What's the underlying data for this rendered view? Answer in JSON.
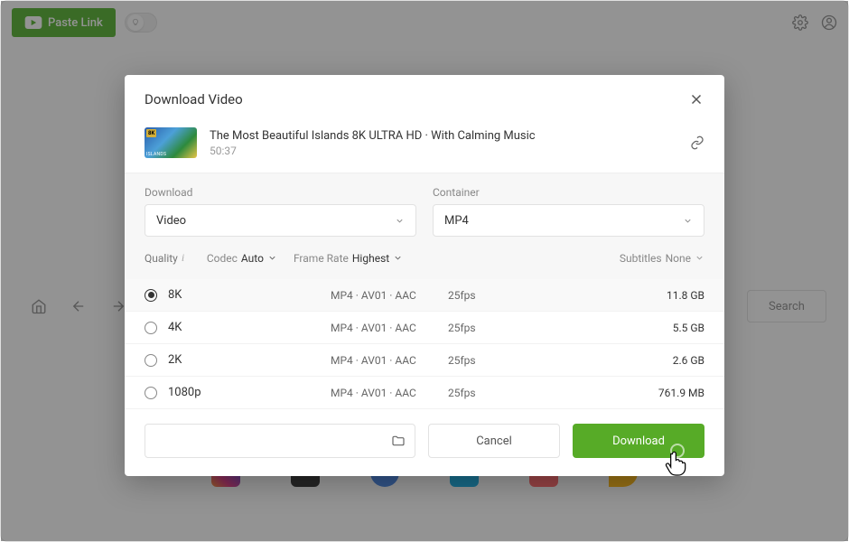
{
  "topBar": {
    "pasteLink": "Paste Link"
  },
  "nav": {
    "searchLabel": "Search"
  },
  "modal": {
    "title": "Download Video",
    "video": {
      "title": "The Most Beautiful Islands 8K ULTRA HD · With Calming Music",
      "duration": "50:37",
      "thumbBadge": "8K"
    },
    "labels": {
      "download": "Download",
      "container": "Container",
      "quality": "Quality",
      "codec": "Codec",
      "frameRate": "Frame Rate",
      "subtitles": "Subtitles"
    },
    "selects": {
      "downloadType": "Video",
      "container": "MP4",
      "codec": "Auto",
      "frameRate": "Highest",
      "subtitles": "None"
    },
    "qualities": [
      {
        "name": "8K",
        "codec": "MP4 · AV01 · AAC",
        "fps": "25fps",
        "size": "11.8 GB",
        "selected": true
      },
      {
        "name": "4K",
        "codec": "MP4 · AV01 · AAC",
        "fps": "25fps",
        "size": "5.5 GB",
        "selected": false
      },
      {
        "name": "2K",
        "codec": "MP4 · AV01 · AAC",
        "fps": "25fps",
        "size": "2.6 GB",
        "selected": false
      },
      {
        "name": "1080p",
        "codec": "MP4 · AV01 · AAC",
        "fps": "25fps",
        "size": "761.9 MB",
        "selected": false
      }
    ],
    "buttons": {
      "cancel": "Cancel",
      "download": "Download"
    }
  },
  "colors": {
    "primary": "#57ab27"
  }
}
